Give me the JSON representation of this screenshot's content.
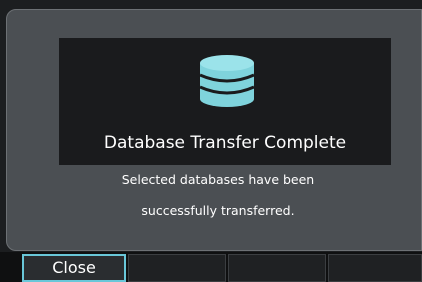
{
  "dialog": {
    "title": "Database Transfer Complete",
    "message_line1": "Selected databases have been",
    "message_line2": "successfully transferred.",
    "icon": "database-icon",
    "icon_color": "#7fd3dc"
  },
  "softkeys": {
    "close_label": "Close",
    "accent": "#69c7d9"
  }
}
